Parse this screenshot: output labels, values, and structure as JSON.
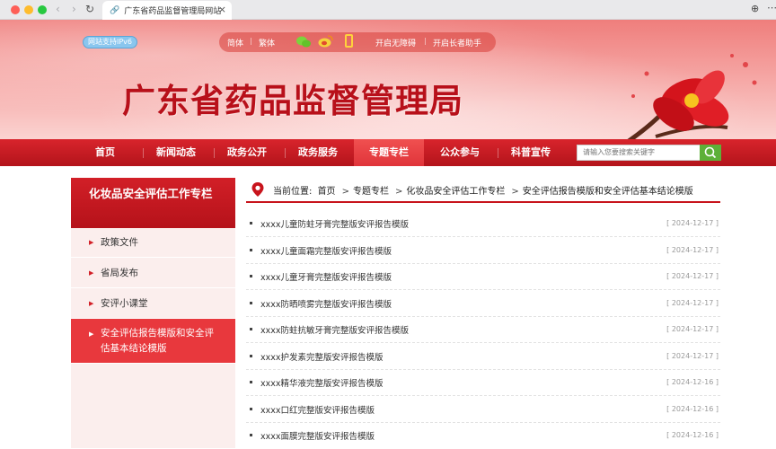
{
  "browser": {
    "tab_title": "广东省药品监督管理局网站",
    "tab_close": "×",
    "back_glyph": "‹",
    "forward_glyph": "›",
    "reload_glyph": "↻",
    "link_glyph": "🔗",
    "globe_glyph": "⊕",
    "more_glyph": "⋯"
  },
  "header": {
    "ipv6_badge": "网站支持IPv6",
    "simplified": "简体",
    "traditional": "繁体",
    "accessibility": "开启无障碍",
    "elder_mode": "开启长者助手",
    "separator": "|",
    "site_title": "广东省药品监督管理局"
  },
  "nav": {
    "items": [
      "首页",
      "新闻动态",
      "政务公开",
      "政务服务",
      "专题专栏",
      "公众参与",
      "科普宣传"
    ],
    "active_index": 4,
    "search_placeholder": "请输入您要搜索关键字"
  },
  "sidebar": {
    "title": "化妆品安全评估工作专栏",
    "items": [
      {
        "label": "政策文件"
      },
      {
        "label": "省局发布"
      },
      {
        "label": "安评小课堂"
      },
      {
        "label": "安全评估报告模版和安全评估基本结论模版"
      }
    ],
    "active_index": 3
  },
  "breadcrumb": {
    "prefix": "当前位置:",
    "items": [
      "首页",
      "专题专栏",
      "化妆品安全评估工作专栏",
      "安全评估报告模版和安全评估基本结论模版"
    ],
    "separator": ">"
  },
  "articles": [
    {
      "title": "xxxx儿童防蛀牙膏完整版安评报告模版",
      "date": "[ 2024-12-17 ]"
    },
    {
      "title": "xxxx儿童面霜完整版安评报告模版",
      "date": "[ 2024-12-17 ]"
    },
    {
      "title": "xxxx儿童牙膏完整版安评报告模版",
      "date": "[ 2024-12-17 ]"
    },
    {
      "title": "xxxx防晒喷雾完整版安评报告模版",
      "date": "[ 2024-12-17 ]"
    },
    {
      "title": "xxxx防蛀抗敏牙膏完整版安评报告模版",
      "date": "[ 2024-12-17 ]"
    },
    {
      "title": "xxxx护发素完整版安评报告模版",
      "date": "[ 2024-12-17 ]"
    },
    {
      "title": "xxxx精华液完整版安评报告模版",
      "date": "[ 2024-12-16 ]"
    },
    {
      "title": "xxxx口红完整版安评报告模版",
      "date": "[ 2024-12-16 ]"
    },
    {
      "title": "xxxx面膜完整版安评报告模版",
      "date": "[ 2024-12-16 ]"
    }
  ],
  "colors": {
    "brand_red": "#c8141c",
    "accent_green": "#5db038"
  }
}
